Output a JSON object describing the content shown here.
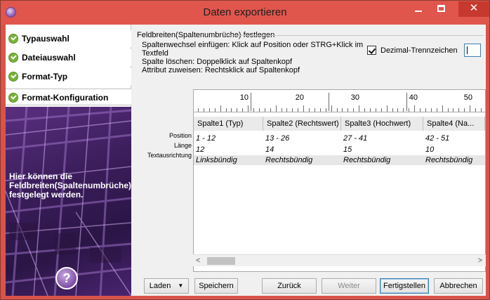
{
  "window": {
    "title": "Daten exportieren",
    "accent_color": "#e0564c"
  },
  "wizard": {
    "steps": [
      {
        "label": "Typauswahl",
        "done": true
      },
      {
        "label": "Dateiauswahl",
        "done": true
      },
      {
        "label": "Format-Typ",
        "done": true
      },
      {
        "label": "Format-Konfiguration",
        "done": true,
        "active": true
      }
    ],
    "help_text": "Hier können die Feldbreiten(Spaltenumbrüche) festgelegt werden.",
    "help_button": "?"
  },
  "config": {
    "group_title": "Feldbreiten(Spaltenumbrüche) festlegen",
    "info_lines": [
      "Spaltenwechsel einfügen: Klick auf Position oder STRG+Klick im",
      "Textfeld",
      "Spalte löschen: Doppelklick auf Spaltenkopf",
      "Attribut zuweisen: Rechtsklick auf Spaltenkopf"
    ],
    "decimal_checkbox_label": "Dezimal-Trennzeichen",
    "decimal_checked": true,
    "decimal_value": ""
  },
  "ruler": {
    "labels": [
      "10",
      "20",
      "30",
      "40",
      "50"
    ]
  },
  "columns": [
    {
      "header": "Spalte1 (Typ)",
      "position": "1 - 12",
      "length": "12",
      "alignment": "Linksbündig"
    },
    {
      "header": "Spalte2 (Rechtswert)",
      "position": "13 - 26",
      "length": "14",
      "alignment": "Rechtsbündig"
    },
    {
      "header": "Spalte3 (Hochwert)",
      "position": "27 - 41",
      "length": "15",
      "alignment": "Rechtsbündig"
    },
    {
      "header": "Spalte4 (Na...",
      "position": "42 - 51",
      "length": "10",
      "alignment": "Rechtsbündig"
    }
  ],
  "row_labels": {
    "position": "Position",
    "length": "Länge",
    "alignment": "Textausrichtung"
  },
  "buttons": {
    "load": "Laden",
    "save": "Speichern",
    "back": "Zurück",
    "next": "Weiter",
    "finish": "Fertigstellen",
    "cancel": "Abbrechen"
  }
}
